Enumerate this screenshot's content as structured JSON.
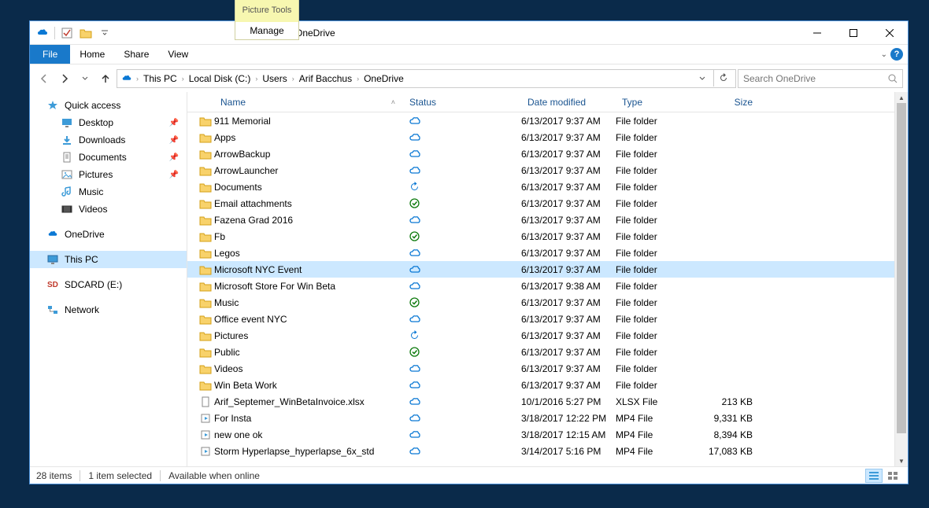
{
  "window": {
    "title": "OneDrive",
    "context_group_header": "Picture Tools",
    "context_group_tab": "Manage"
  },
  "ribbon": {
    "tabs": [
      "File",
      "Home",
      "Share",
      "View"
    ]
  },
  "breadcrumbs": [
    "This PC",
    "Local Disk (C:)",
    "Users",
    "Arif Bacchus",
    "OneDrive"
  ],
  "search": {
    "placeholder": "Search OneDrive"
  },
  "navpane": {
    "quick_access": "Quick access",
    "quick_items": [
      {
        "label": "Desktop",
        "icon": "desktop",
        "pinned": true
      },
      {
        "label": "Downloads",
        "icon": "downloads",
        "pinned": true
      },
      {
        "label": "Documents",
        "icon": "documents",
        "pinned": true
      },
      {
        "label": "Pictures",
        "icon": "pictures",
        "pinned": true
      },
      {
        "label": "Music",
        "icon": "music",
        "pinned": false
      },
      {
        "label": "Videos",
        "icon": "videos",
        "pinned": false
      }
    ],
    "onedrive": "OneDrive",
    "this_pc": "This PC",
    "sdcard": "SDCARD (E:)",
    "network": "Network"
  },
  "columns": {
    "name": "Name",
    "status": "Status",
    "date": "Date modified",
    "type": "Type",
    "size": "Size"
  },
  "files": [
    {
      "name": "911 Memorial",
      "status": "cloud",
      "date": "6/13/2017 9:37 AM",
      "type": "File folder",
      "size": "",
      "icon": "folder"
    },
    {
      "name": "Apps",
      "status": "cloud",
      "date": "6/13/2017 9:37 AM",
      "type": "File folder",
      "size": "",
      "icon": "folder"
    },
    {
      "name": "ArrowBackup",
      "status": "cloud",
      "date": "6/13/2017 9:37 AM",
      "type": "File folder",
      "size": "",
      "icon": "folder"
    },
    {
      "name": "ArrowLauncher",
      "status": "cloud",
      "date": "6/13/2017 9:37 AM",
      "type": "File folder",
      "size": "",
      "icon": "folder"
    },
    {
      "name": "Documents",
      "status": "sync",
      "date": "6/13/2017 9:37 AM",
      "type": "File folder",
      "size": "",
      "icon": "folder"
    },
    {
      "name": "Email attachments",
      "status": "ok",
      "date": "6/13/2017 9:37 AM",
      "type": "File folder",
      "size": "",
      "icon": "folder"
    },
    {
      "name": "Fazena Grad 2016",
      "status": "cloud",
      "date": "6/13/2017 9:37 AM",
      "type": "File folder",
      "size": "",
      "icon": "folder"
    },
    {
      "name": "Fb",
      "status": "ok",
      "date": "6/13/2017 9:37 AM",
      "type": "File folder",
      "size": "",
      "icon": "folder"
    },
    {
      "name": "Legos",
      "status": "cloud",
      "date": "6/13/2017 9:37 AM",
      "type": "File folder",
      "size": "",
      "icon": "folder"
    },
    {
      "name": "Microsoft NYC Event",
      "status": "cloud",
      "date": "6/13/2017 9:37 AM",
      "type": "File folder",
      "size": "",
      "icon": "folder",
      "selected": true
    },
    {
      "name": "Microsoft Store For Win Beta",
      "status": "cloud",
      "date": "6/13/2017 9:38 AM",
      "type": "File folder",
      "size": "",
      "icon": "folder"
    },
    {
      "name": "Music",
      "status": "ok",
      "date": "6/13/2017 9:37 AM",
      "type": "File folder",
      "size": "",
      "icon": "folder"
    },
    {
      "name": "Office event NYC",
      "status": "cloud",
      "date": "6/13/2017 9:37 AM",
      "type": "File folder",
      "size": "",
      "icon": "folder"
    },
    {
      "name": "Pictures",
      "status": "sync",
      "date": "6/13/2017 9:37 AM",
      "type": "File folder",
      "size": "",
      "icon": "folder"
    },
    {
      "name": "Public",
      "status": "ok",
      "date": "6/13/2017 9:37 AM",
      "type": "File folder",
      "size": "",
      "icon": "folder"
    },
    {
      "name": "Videos",
      "status": "cloud",
      "date": "6/13/2017 9:37 AM",
      "type": "File folder",
      "size": "",
      "icon": "folder"
    },
    {
      "name": "Win Beta Work",
      "status": "cloud",
      "date": "6/13/2017 9:37 AM",
      "type": "File folder",
      "size": "",
      "icon": "folder"
    },
    {
      "name": "Arif_Septemer_WinBetaInvoice.xlsx",
      "status": "cloud",
      "date": "10/1/2016 5:27 PM",
      "type": "XLSX File",
      "size": "213 KB",
      "icon": "file"
    },
    {
      "name": "For Insta",
      "status": "cloud",
      "date": "3/18/2017 12:22 PM",
      "type": "MP4 File",
      "size": "9,331 KB",
      "icon": "video"
    },
    {
      "name": "new one ok",
      "status": "cloud",
      "date": "3/18/2017 12:15 AM",
      "type": "MP4 File",
      "size": "8,394 KB",
      "icon": "video"
    },
    {
      "name": "Storm Hyperlapse_hyperlapse_6x_std",
      "status": "cloud",
      "date": "3/14/2017 5:16 PM",
      "type": "MP4 File",
      "size": "17,083 KB",
      "icon": "video"
    }
  ],
  "statusbar": {
    "items_count": "28 items",
    "selected": "1 item selected",
    "detail": "Available when online"
  },
  "colors": {
    "accent": "#1979ca",
    "select": "#cce8ff"
  }
}
